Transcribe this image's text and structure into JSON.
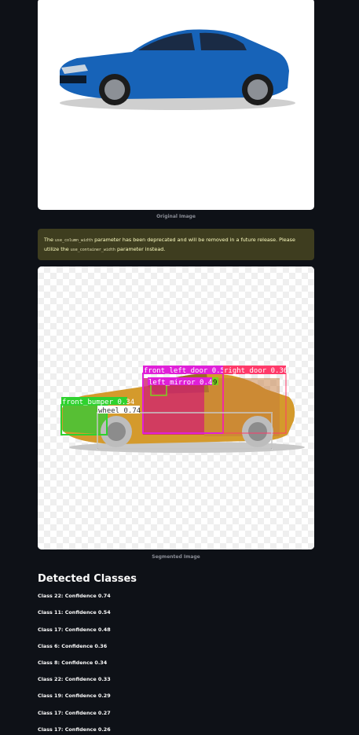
{
  "original": {
    "caption": "Original Image"
  },
  "warning": {
    "prefix": "The ",
    "old_param": "use_column_width",
    "middle": " parameter has been deprecated and will be removed in a future release. Please utilize the ",
    "new_param": "use_container_width",
    "suffix": " parameter instead."
  },
  "segmented": {
    "caption": "Segmented Image",
    "detections": [
      {
        "label": "front_left_door 0.54",
        "color": "#e020d8"
      },
      {
        "label": "right_door 0.36",
        "color": "#ff3a6a"
      },
      {
        "label": "left_mirror 0.48",
        "color": "#e020d8"
      },
      {
        "label": "9",
        "color": "#7bd11e"
      },
      {
        "label": "front_bumper 0.34",
        "color": "#2fd22f"
      },
      {
        "label": "wheel 0.74",
        "color": "#ffffff"
      }
    ]
  },
  "detected": {
    "heading": "Detected Classes",
    "items": [
      "Class 22: Confidence 0.74",
      "Class 11: Confidence 0.54",
      "Class 17: Confidence 0.48",
      "Class 6: Confidence 0.36",
      "Class 8: Confidence 0.34",
      "Class 22: Confidence 0.33",
      "Class 19: Confidence 0.29",
      "Class 17: Confidence 0.27",
      "Class 17: Confidence 0.26"
    ]
  }
}
